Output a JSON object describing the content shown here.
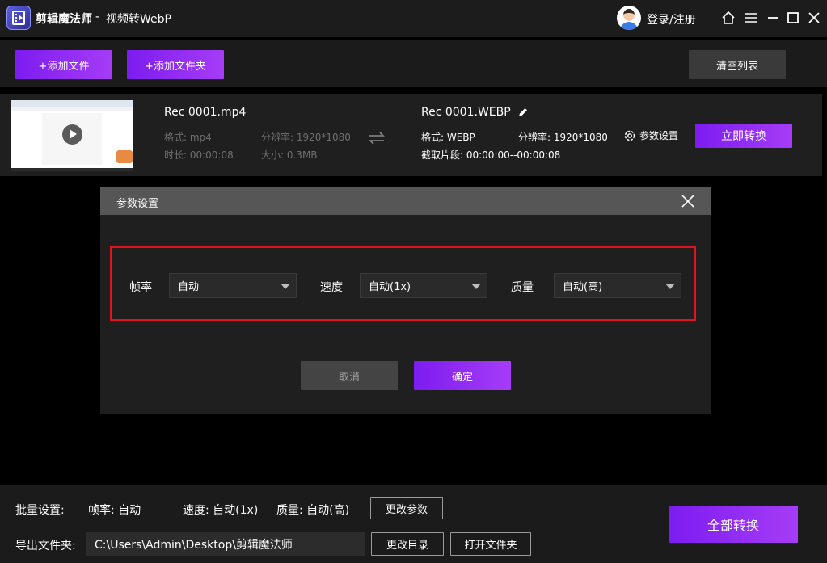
{
  "titlebar": {
    "app_name": "剪辑魔法师",
    "separator": "-",
    "subtitle": "视频转WebP",
    "login_label": "登录/注册",
    "icons": [
      "home-icon",
      "menu-icon",
      "minimize-icon",
      "maximize-icon",
      "close-icon"
    ]
  },
  "toolbar": {
    "add_file_label": "+添加文件",
    "add_folder_label": "+添加文件夹",
    "clear_list_label": "清空列表"
  },
  "file": {
    "source": {
      "name": "Rec 0001.mp4",
      "format": "格式: mp4",
      "resolution": "分辨率: 1920*1080",
      "duration": "时长: 00:00:08",
      "size": "大小: 0.3MB"
    },
    "output": {
      "name": "Rec 0001.WEBP",
      "format": "格式: WEBP",
      "resolution": "分辨率: 1920*1080",
      "clip": "截取片段: 00:00:00--00:00:08"
    },
    "params_label": "参数设置",
    "convert_now_label": "立即转换"
  },
  "dialog": {
    "title": "参数设置",
    "fps_label": "帧率",
    "fps_value": "自动",
    "speed_label": "速度",
    "speed_value": "自动(1x)",
    "quality_label": "质量",
    "quality_value": "自动(高)",
    "cancel_label": "取消",
    "ok_label": "确定"
  },
  "bottom": {
    "batch_label": "批量设置:",
    "batch_fps": "帧率: 自动",
    "batch_speed": "速度: 自动(1x)",
    "batch_quality": "质量: 自动(高)",
    "change_params_label": "更改参数",
    "export_label": "导出文件夹:",
    "export_path": "C:\\Users\\Admin\\Desktop\\剪辑魔法师",
    "change_dir_label": "更改目录",
    "open_folder_label": "打开文件夹",
    "convert_all_label": "全部转换"
  },
  "colors": {
    "accent_start": "#7c1cf0",
    "accent_end": "#a63cf6",
    "highlight": "#e0141e",
    "background": "#000000"
  }
}
